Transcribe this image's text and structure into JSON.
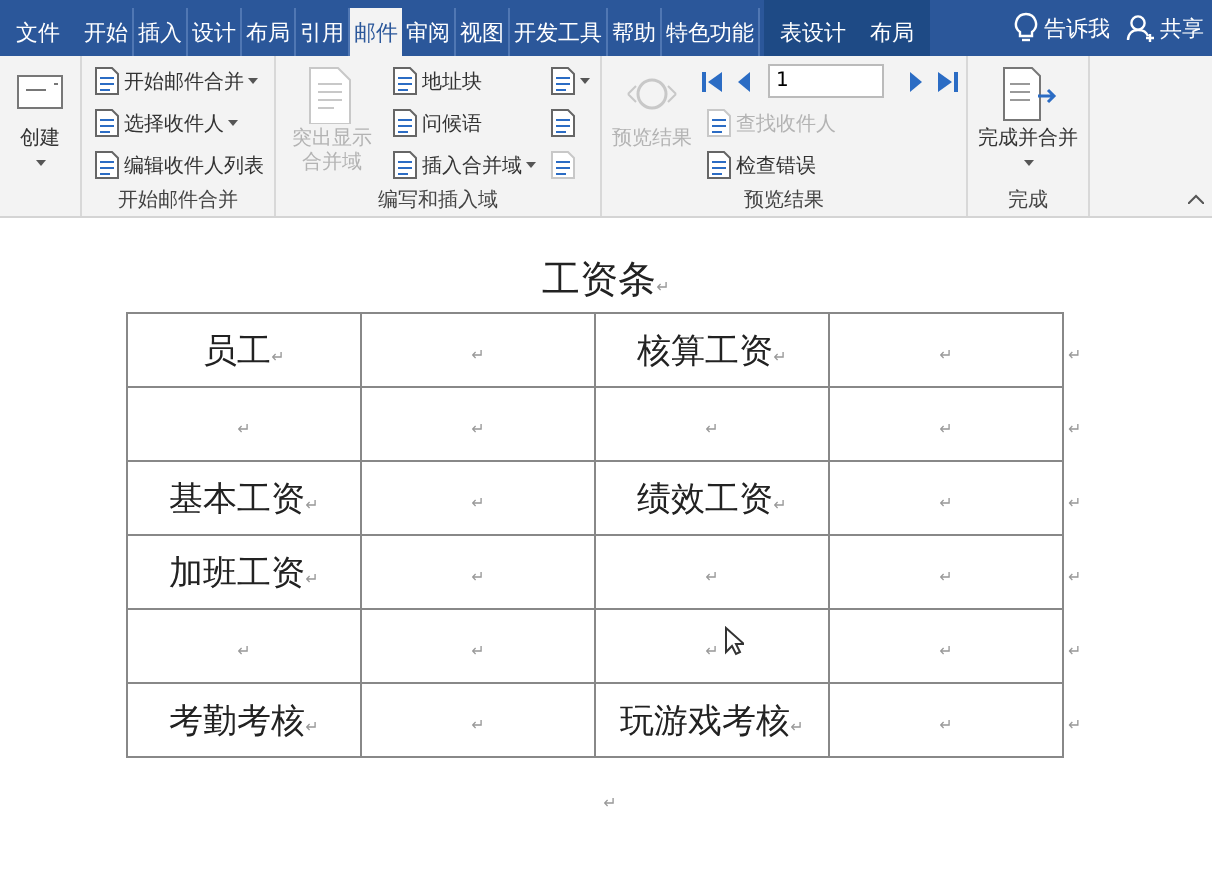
{
  "tabs": [
    {
      "label": "文件",
      "selected": false,
      "contextual": false
    },
    {
      "label": "开始",
      "selected": false,
      "contextual": false
    },
    {
      "label": "插入",
      "selected": false,
      "contextual": false
    },
    {
      "label": "设计",
      "selected": false,
      "contextual": false
    },
    {
      "label": "布局",
      "selected": false,
      "contextual": false
    },
    {
      "label": "引用",
      "selected": false,
      "contextual": false
    },
    {
      "label": "邮件",
      "selected": true,
      "contextual": false
    },
    {
      "label": "审阅",
      "selected": false,
      "contextual": false
    },
    {
      "label": "视图",
      "selected": false,
      "contextual": false
    },
    {
      "label": "开发工具",
      "selected": false,
      "contextual": false
    },
    {
      "label": "帮助",
      "selected": false,
      "contextual": false
    },
    {
      "label": "特色功能",
      "selected": false,
      "contextual": false
    },
    {
      "label": "表设计",
      "selected": false,
      "contextual": true
    },
    {
      "label": "布局",
      "selected": false,
      "contextual": true
    }
  ],
  "tell_me": "告诉我",
  "share": "共享",
  "ribbon_groups": [
    {
      "columns": [
        {
          "kind": "large",
          "text": "创建",
          "caret": true,
          "disabled": false
        }
      ]
    },
    {
      "label": "开始邮件合并",
      "columns": [
        {
          "kind": "stack",
          "items": [
            {
              "text": "开始邮件合并",
              "caret": true,
              "disabled": false
            },
            {
              "text": "选择收件人",
              "caret": true,
              "disabled": false
            },
            {
              "text": "编辑收件人列表",
              "caret": false,
              "disabled": false
            }
          ]
        }
      ]
    },
    {
      "label": "编写和插入域",
      "columns": [
        {
          "kind": "large",
          "text": "突出显示合并域",
          "caret": false,
          "disabled": true
        },
        {
          "kind": "stack",
          "items": [
            {
              "text": "地址块",
              "caret": false,
              "disabled": false
            },
            {
              "text": "问候语",
              "caret": false,
              "disabled": false
            },
            {
              "text": "插入合并域",
              "caret": true,
              "disabled": false
            }
          ]
        },
        {
          "kind": "stack",
          "items": [
            {
              "caret": true,
              "disabled": false
            },
            {
              "caret": false,
              "disabled": false
            },
            {
              "caret": false,
              "disabled": true
            }
          ]
        }
      ]
    },
    {
      "label": "预览结果",
      "columns": [
        {
          "kind": "large",
          "text": "预览结果",
          "caret": false,
          "disabled": true
        },
        {
          "kind": "stack",
          "items": [
            {
              "kind": "nav",
              "record": "1"
            },
            {
              "text": "查找收件人",
              "caret": false,
              "disabled": true
            },
            {
              "text": "检查错误",
              "caret": false,
              "disabled": false
            }
          ]
        }
      ]
    },
    {
      "label": "完成",
      "columns": [
        {
          "kind": "large",
          "text": "完成并合并",
          "caret": true,
          "disabled": false
        }
      ]
    }
  ],
  "document": {
    "title": "工资条",
    "mark": "↵",
    "table": {
      "rows": [
        {
          "cells": [
            {
              "text": "员工",
              "mark": "↵"
            },
            {
              "mark": "↵"
            },
            {
              "text": "核算工资",
              "mark": "↵"
            },
            {
              "mark": "↵"
            }
          ],
          "end_mark": "↵"
        },
        {
          "cells": [
            {
              "mark": "↵"
            },
            {
              "mark": "↵"
            },
            {
              "mark": "↵"
            },
            {
              "mark": "↵"
            }
          ],
          "end_mark": "↵"
        },
        {
          "cells": [
            {
              "text": "基本工资",
              "mark": "↵"
            },
            {
              "mark": "↵"
            },
            {
              "text": "绩效工资",
              "mark": "↵"
            },
            {
              "mark": "↵"
            }
          ],
          "end_mark": "↵"
        },
        {
          "cells": [
            {
              "text": "加班工资",
              "mark": "↵"
            },
            {
              "mark": "↵"
            },
            {
              "mark": "↵"
            },
            {
              "mark": "↵"
            }
          ],
          "end_mark": "↵"
        },
        {
          "cells": [
            {
              "mark": "↵"
            },
            {
              "mark": "↵"
            },
            {
              "mark": "↵"
            },
            {
              "mark": "↵"
            }
          ],
          "end_mark": "↵"
        },
        {
          "cells": [
            {
              "text": "考勤考核",
              "mark": "↵"
            },
            {
              "mark": "↵"
            },
            {
              "text": "玩游戏考核",
              "mark": "↵"
            },
            {
              "mark": "↵"
            }
          ],
          "end_mark": "↵"
        }
      ]
    },
    "after_mark": "↵"
  }
}
